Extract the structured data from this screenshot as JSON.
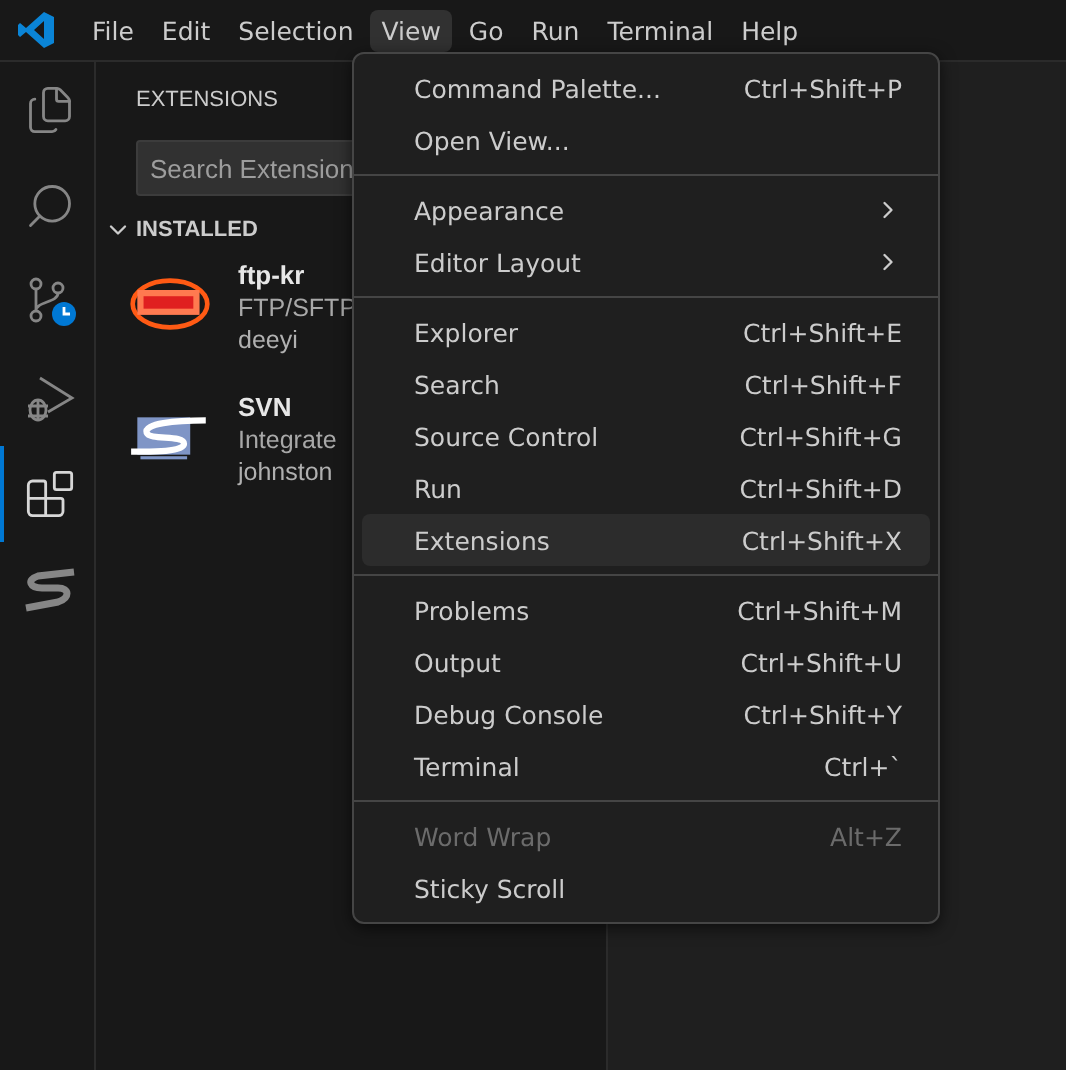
{
  "menubar": [
    {
      "label": "File",
      "selected": false
    },
    {
      "label": "Edit",
      "selected": false
    },
    {
      "label": "Selection",
      "selected": false
    },
    {
      "label": "View",
      "selected": true
    },
    {
      "label": "Go",
      "selected": false
    },
    {
      "label": "Run",
      "selected": false
    },
    {
      "label": "Terminal",
      "selected": false
    },
    {
      "label": "Help",
      "selected": false
    }
  ],
  "activity_bar": [
    {
      "kind": "explorer",
      "selected": false
    },
    {
      "kind": "search",
      "selected": false
    },
    {
      "kind": "source-control",
      "selected": false
    },
    {
      "kind": "run",
      "selected": false
    },
    {
      "kind": "extensions",
      "selected": true
    },
    {
      "kind": "svn",
      "selected": false
    }
  ],
  "sidebar": {
    "title": "EXTENSIONS",
    "search": {
      "placeholder": "Search Extension"
    },
    "section": {
      "label": "INSTALLED",
      "expanded": true
    },
    "extensions": [
      {
        "kind": "ftp",
        "name": "ftp-kr",
        "description": "FTP/SFTP",
        "publisher": "deeyi"
      },
      {
        "kind": "svn",
        "name": "SVN",
        "description": "Integrate",
        "publisher": "johnston"
      }
    ]
  },
  "view_menu": [
    [
      {
        "label": "Command Palette...",
        "shortcut": "Ctrl+Shift+P",
        "kind": "command",
        "selected": false,
        "disabled": false
      },
      {
        "label": "Open View...",
        "kind": "command",
        "selected": false,
        "disabled": false
      }
    ],
    [
      {
        "label": "Appearance",
        "kind": "submenu",
        "selected": false,
        "disabled": false
      },
      {
        "label": "Editor Layout",
        "kind": "submenu",
        "selected": false,
        "disabled": false
      }
    ],
    [
      {
        "label": "Explorer",
        "shortcut": "Ctrl+Shift+E",
        "kind": "command",
        "selected": false,
        "disabled": false
      },
      {
        "label": "Search",
        "shortcut": "Ctrl+Shift+F",
        "kind": "command",
        "selected": false,
        "disabled": false
      },
      {
        "label": "Source Control",
        "shortcut": "Ctrl+Shift+G",
        "kind": "command",
        "selected": false,
        "disabled": false
      },
      {
        "label": "Run",
        "shortcut": "Ctrl+Shift+D",
        "kind": "command",
        "selected": false,
        "disabled": false
      },
      {
        "label": "Extensions",
        "shortcut": "Ctrl+Shift+X",
        "kind": "command",
        "selected": true,
        "disabled": false
      }
    ],
    [
      {
        "label": "Problems",
        "shortcut": "Ctrl+Shift+M",
        "kind": "command",
        "selected": false,
        "disabled": false
      },
      {
        "label": "Output",
        "shortcut": "Ctrl+Shift+U",
        "kind": "command",
        "selected": false,
        "disabled": false
      },
      {
        "label": "Debug Console",
        "shortcut": "Ctrl+Shift+Y",
        "kind": "command",
        "selected": false,
        "disabled": false
      },
      {
        "label": "Terminal",
        "shortcut": "Ctrl+`",
        "kind": "command",
        "selected": false,
        "disabled": false
      }
    ],
    [
      {
        "label": "Word Wrap",
        "shortcut": "Alt+Z",
        "kind": "command",
        "selected": false,
        "disabled": true
      },
      {
        "label": "Sticky Scroll",
        "kind": "command",
        "selected": false,
        "disabled": false
      }
    ]
  ]
}
